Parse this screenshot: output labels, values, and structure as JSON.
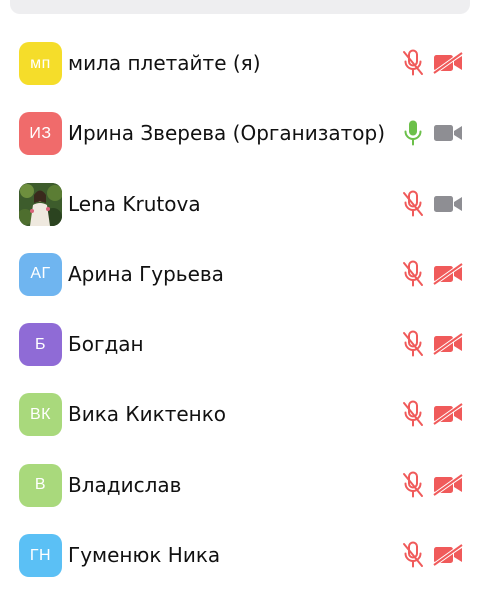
{
  "participants": [
    {
      "initials": "мп",
      "name": "мила плетайте (я)",
      "avatar_color": "#f5dd2a",
      "avatar_type": "initials",
      "mic": "muted",
      "video": "off"
    },
    {
      "initials": "ИЗ",
      "name": "Ирина Зверева (Организатор)",
      "avatar_color": "#f06b6b",
      "avatar_type": "initials",
      "mic": "active",
      "video": "on"
    },
    {
      "initials": "",
      "name": "Lena Krutova",
      "avatar_color": "#2f4a27",
      "avatar_type": "photo",
      "mic": "muted",
      "video": "on"
    },
    {
      "initials": "АГ",
      "name": "Арина Гурьева",
      "avatar_color": "#6fb5f0",
      "avatar_type": "initials",
      "mic": "muted",
      "video": "off"
    },
    {
      "initials": "Б",
      "name": "Богдан",
      "avatar_color": "#8f6bd6",
      "avatar_type": "initials",
      "mic": "muted",
      "video": "off"
    },
    {
      "initials": "ВК",
      "name": "Вика Киктенко",
      "avatar_color": "#a9d97c",
      "avatar_type": "initials",
      "mic": "muted",
      "video": "off"
    },
    {
      "initials": "В",
      "name": "Владислав",
      "avatar_color": "#a9d97c",
      "avatar_type": "initials",
      "mic": "muted",
      "video": "off"
    },
    {
      "initials": "ГН",
      "name": "Гуменюк Ника",
      "avatar_color": "#5bc0f5",
      "avatar_type": "initials",
      "mic": "muted",
      "video": "off"
    }
  ],
  "colors": {
    "muted_red": "#f05a5a",
    "mic_active_green": "#6cc04a",
    "icon_gray": "#8e8e93",
    "search_bar_bg": "#eeeef0"
  },
  "icons": {
    "mic_muted": "microphone-muted-icon",
    "mic_active": "microphone-icon",
    "video_on": "video-camera-icon",
    "video_off": "video-camera-off-icon"
  }
}
